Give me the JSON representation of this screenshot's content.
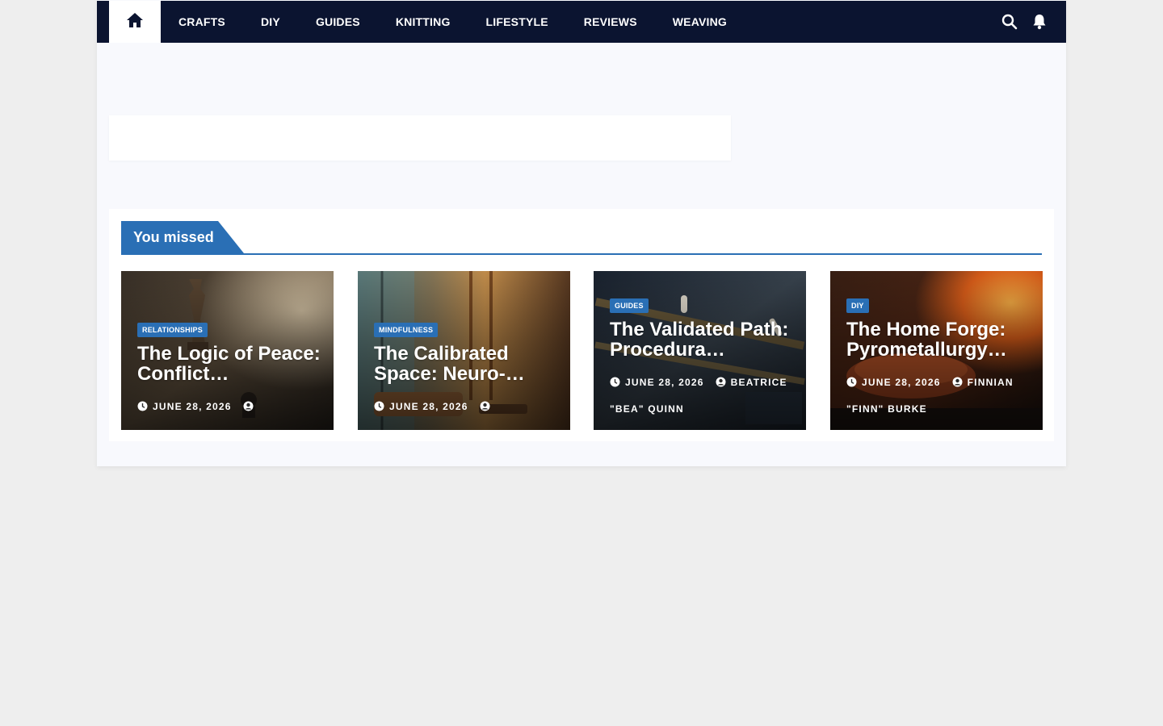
{
  "nav": {
    "items": [
      "Crafts",
      "DIY",
      "Guides",
      "Knitting",
      "Lifestyle",
      "Reviews",
      "Weaving"
    ]
  },
  "icons": {
    "home": "home-icon",
    "search": "search-icon",
    "notifications": "bell-icon",
    "date": "clock-icon",
    "author": "user-icon"
  },
  "colors": {
    "nav_bg": "#0b1430",
    "accent": "#2a6fb5",
    "page_bg": "#eeeeee"
  },
  "missed": {
    "title": "You missed",
    "cards": [
      {
        "category": "RELATIONSHIPS",
        "title": "The Logic of Peace: Conflict…",
        "date": "JUNE 28, 2026",
        "author": ""
      },
      {
        "category": "MINDFULNESS",
        "title": "The Calibrated Space: Neuro-…",
        "date": "JUNE 28, 2026",
        "author": ""
      },
      {
        "category": "GUIDES",
        "title": "The Validated Path: Procedura…",
        "date": "JUNE 28, 2026",
        "author": "BEATRICE \"BEA\" QUINN"
      },
      {
        "category": "DIY",
        "title": "The Home Forge: Pyrometallurgy…",
        "date": "JUNE 28, 2026",
        "author": "FINNIAN \"FINN\" BURKE"
      }
    ]
  }
}
